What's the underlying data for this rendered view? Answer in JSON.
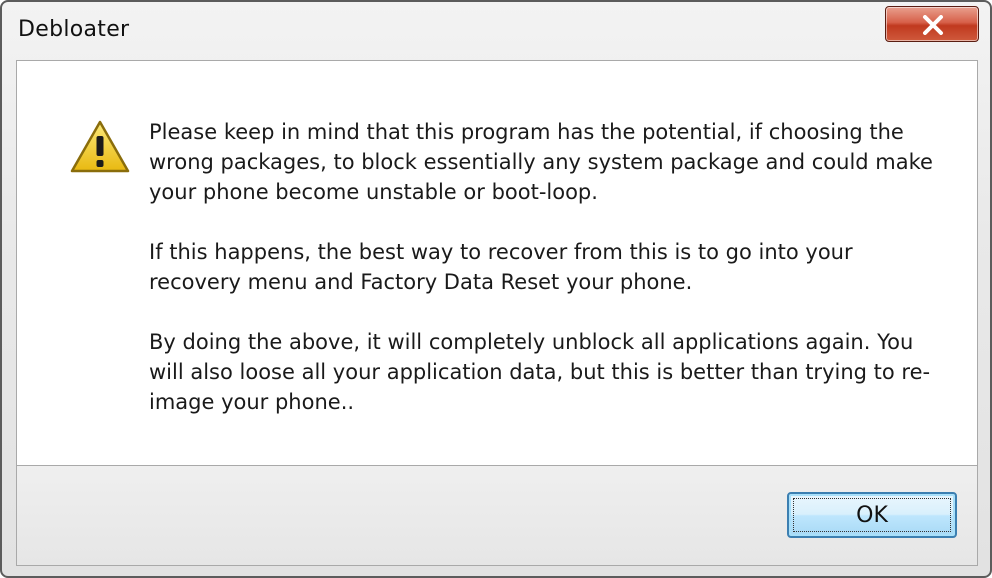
{
  "window": {
    "title": "Debloater",
    "close_icon": "close-icon"
  },
  "dialog": {
    "icon": "warning-icon",
    "paragraphs": [
      "Please keep in mind that this program has the potential, if choosing the wrong packages, to block essentially any system package and could make your phone become unstable or boot-loop.",
      "If this happens, the best way to recover from this is to go into your recovery menu and Factory Data Reset your phone.",
      "By doing the above, it will completely unblock all applications again. You will also loose all your application data, but this is better than trying to re-image your phone.."
    ]
  },
  "buttons": {
    "ok_label": "OK"
  },
  "colors": {
    "close_button": "#c0391f",
    "ok_border": "#3c7fb1",
    "warning_fill": "#f5d63d"
  }
}
